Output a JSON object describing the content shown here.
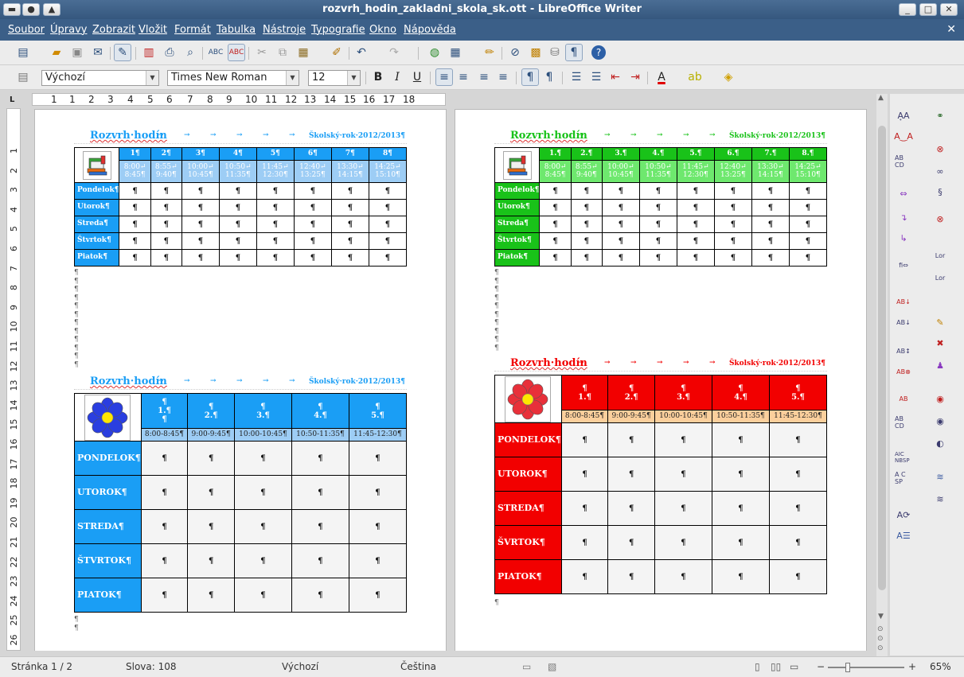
{
  "window": {
    "title": "rozvrh_hodin_zakladni_skola_sk.ott - LibreOffice Writer"
  },
  "menu": [
    "Soubor",
    "Úpravy",
    "Zobrazit",
    "Vložit",
    "Formát",
    "Tabulka",
    "Nástroje",
    "Typografie",
    "Okno",
    "Nápověda"
  ],
  "format_bar": {
    "style": "Výchozí",
    "font": "Times New Roman",
    "size": "12"
  },
  "ruler": {
    "ticks": [
      "1",
      "1",
      "2",
      "3",
      "4",
      "5",
      "6",
      "7",
      "8",
      "9",
      "10",
      "11",
      "12",
      "13",
      "14",
      "15",
      "16",
      "17",
      "18"
    ]
  },
  "vruler": {
    "ticks": [
      "1",
      "2",
      "3",
      "4",
      "5",
      "6",
      "7",
      "8",
      "9",
      "10",
      "11",
      "12",
      "13",
      "14",
      "15",
      "16",
      "17",
      "18",
      "19",
      "20",
      "21",
      "22",
      "23",
      "24",
      "25",
      "26"
    ]
  },
  "status": {
    "page": "Stránka 1 / 2",
    "words": "Slova: 108",
    "style": "Výchozí",
    "language": "Čeština",
    "zoom": "65%"
  },
  "colors": {
    "blue": "#1a9ef5",
    "blue_light": "#9dcdf5",
    "green": "#19c219",
    "green_light": "#6ee86e",
    "red": "#f20000",
    "peach": "#fbcf9c"
  },
  "tables": {
    "t1": {
      "title": "Rozvrh·hodín",
      "year": "Školský·rok·2012/2013¶",
      "periods": [
        "1¶",
        "2¶",
        "3¶",
        "4¶",
        "5¶",
        "6¶",
        "7¶",
        "8¶"
      ],
      "times": [
        [
          "8:00",
          "8:45¶"
        ],
        [
          "8:55",
          "9:40¶"
        ],
        [
          "10:00",
          "10:45¶"
        ],
        [
          "10:50",
          "11:35¶"
        ],
        [
          "11:45",
          "12:30¶"
        ],
        [
          "12:40",
          "13:25¶"
        ],
        [
          "13:30",
          "14:15¶"
        ],
        [
          "14:25",
          "15:10¶"
        ]
      ],
      "days": [
        "Pondelok¶",
        "Utorok¶",
        "Streda¶",
        "Štvrtok¶",
        "Piatok¶"
      ]
    },
    "t2": {
      "title": "Rozvrh·hodín",
      "year": "Školský·rok·2012/2013¶",
      "periods": [
        "1.¶",
        "2.¶",
        "3.¶",
        "4.¶",
        "5.¶",
        "6.¶",
        "7.¶",
        "8.¶"
      ],
      "times": [
        [
          "8:00",
          "8:45¶"
        ],
        [
          "8:55",
          "9:40¶"
        ],
        [
          "10:00",
          "10:45¶"
        ],
        [
          "10:50",
          "11:35¶"
        ],
        [
          "11:45",
          "12:30¶"
        ],
        [
          "12:40",
          "13:25¶"
        ],
        [
          "13:30",
          "14:15¶"
        ],
        [
          "14:25",
          "15:10¶"
        ]
      ],
      "days": [
        "Pondelok¶",
        "Utorok¶",
        "Streda¶",
        "Štvrtok¶",
        "Piatok¶"
      ]
    },
    "t3": {
      "title": "Rozvrh·hodín",
      "year": "Školský·rok·2012/2013¶",
      "periods": [
        "1.¶",
        "2.¶",
        "3.¶",
        "4.¶",
        "5.¶"
      ],
      "times": [
        "8:00-8:45¶",
        "9:00-9:45¶",
        "10:00-10:45¶",
        "10:50-11:35¶",
        "11:45-12:30¶"
      ],
      "days": [
        "PONDELOK¶",
        "UTOROK¶",
        "STREDA¶",
        "ŠTVRTOK¶",
        "PIATOK¶"
      ]
    },
    "t4": {
      "title": "Rozvrh·hodín",
      "year": "Školský·rok·2012/2013¶",
      "periods": [
        "1.¶",
        "2.¶",
        "3.¶",
        "4.¶",
        "5.¶"
      ],
      "times": [
        "8:00-8:45¶",
        "9:00-9:45¶",
        "10:00-10:45¶",
        "10:50-11:35¶",
        "11:45-12:30¶"
      ],
      "days": [
        "PONDELOK¶",
        "UTOROK¶",
        "STREDA¶",
        "ŠVRTOK¶",
        "PIATOK¶"
      ]
    }
  },
  "cell_mark": "¶",
  "arrow": "→"
}
